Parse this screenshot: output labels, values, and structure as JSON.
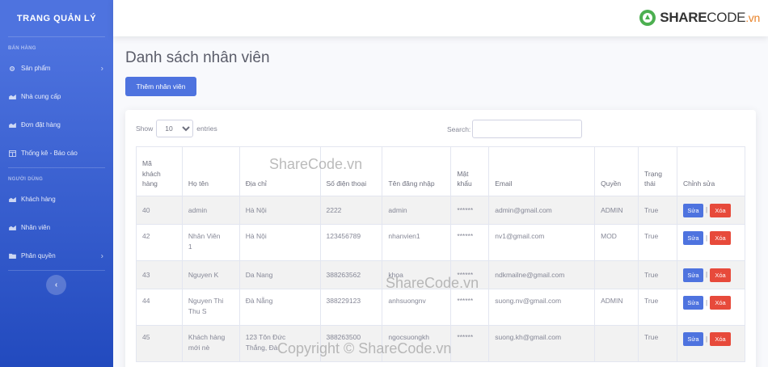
{
  "sidebar": {
    "brand": "TRANG QUẢN LÝ",
    "section_sales": "BÁN HÀNG",
    "section_users": "NGƯỜI DÙNG",
    "items": [
      {
        "label": "Sản phẩm",
        "icon": "gear-icon"
      },
      {
        "label": "Nhà cung cấp",
        "icon": "chart-area-icon"
      },
      {
        "label": "Đơn đặt hàng",
        "icon": "chart-area-icon"
      },
      {
        "label": "Thống kê - Báo cáo",
        "icon": "table-icon"
      },
      {
        "label": "Khách hàng",
        "icon": "chart-area-icon"
      },
      {
        "label": "Nhân viên",
        "icon": "chart-area-icon"
      },
      {
        "label": "Phân quyền",
        "icon": "folder-icon"
      }
    ],
    "toggle": "‹"
  },
  "topbar": {
    "logo": {
      "share": "SHARE",
      "code": "CODE",
      "vn": ".vn"
    }
  },
  "main": {
    "title": "Danh sách nhân viên",
    "add_button": "Thêm nhân viên",
    "show_label": "Show",
    "show_value": "10",
    "entries_label": "entries",
    "search_label": "Search:"
  },
  "table": {
    "headers": [
      "Mã\nkhách\nhàng",
      "Họ tên",
      "Địa chỉ",
      "Số điện thoại",
      "Tên đăng nhập",
      "Mật\nkhẩu",
      "Email",
      "Quyền",
      "Trạng\nthái",
      "Chỉnh sửa"
    ],
    "rows": [
      {
        "id": "40",
        "name": "admin",
        "address": "Hà Nội",
        "phone": "2222",
        "username": "admin",
        "password": "******",
        "email": "admin@gmail.com",
        "role": "ADMIN",
        "status": "True"
      },
      {
        "id": "42",
        "name": "Nhân Viên\n1",
        "address": "Hà Nội",
        "phone": "123456789",
        "username": "nhanvien1",
        "password": "******",
        "email": "nv1@gmail.com",
        "role": "MOD",
        "status": "True"
      },
      {
        "id": "43",
        "name": "Nguyen K",
        "address": "Da Nang",
        "phone": "388263562",
        "username": "khoa",
        "password": "******",
        "email": "ndkmailne@gmail.com",
        "role": "",
        "status": "True"
      },
      {
        "id": "44",
        "name": "Nguyen Thi\nThu S",
        "address": "Đà Nẵng",
        "phone": "388229123",
        "username": "anhsuongnv",
        "password": "******",
        "email": "suong.nv@gmail.com",
        "role": "ADMIN",
        "status": "True"
      },
      {
        "id": "45",
        "name": "Khách hàng\nmới nè",
        "address": "123 Tôn Đức\nThắng, Đà",
        "phone": "388263500",
        "username": "ngocsuongkh",
        "password": "******",
        "email": "suong.kh@gmail.com",
        "role": "",
        "status": "True"
      }
    ],
    "edit_label": "Sửa",
    "delete_label": "Xóa",
    "separator": "|"
  },
  "watermarks": [
    "ShareCode.vn",
    "ShareCode.vn",
    "Copyright © ShareCode.vn"
  ]
}
